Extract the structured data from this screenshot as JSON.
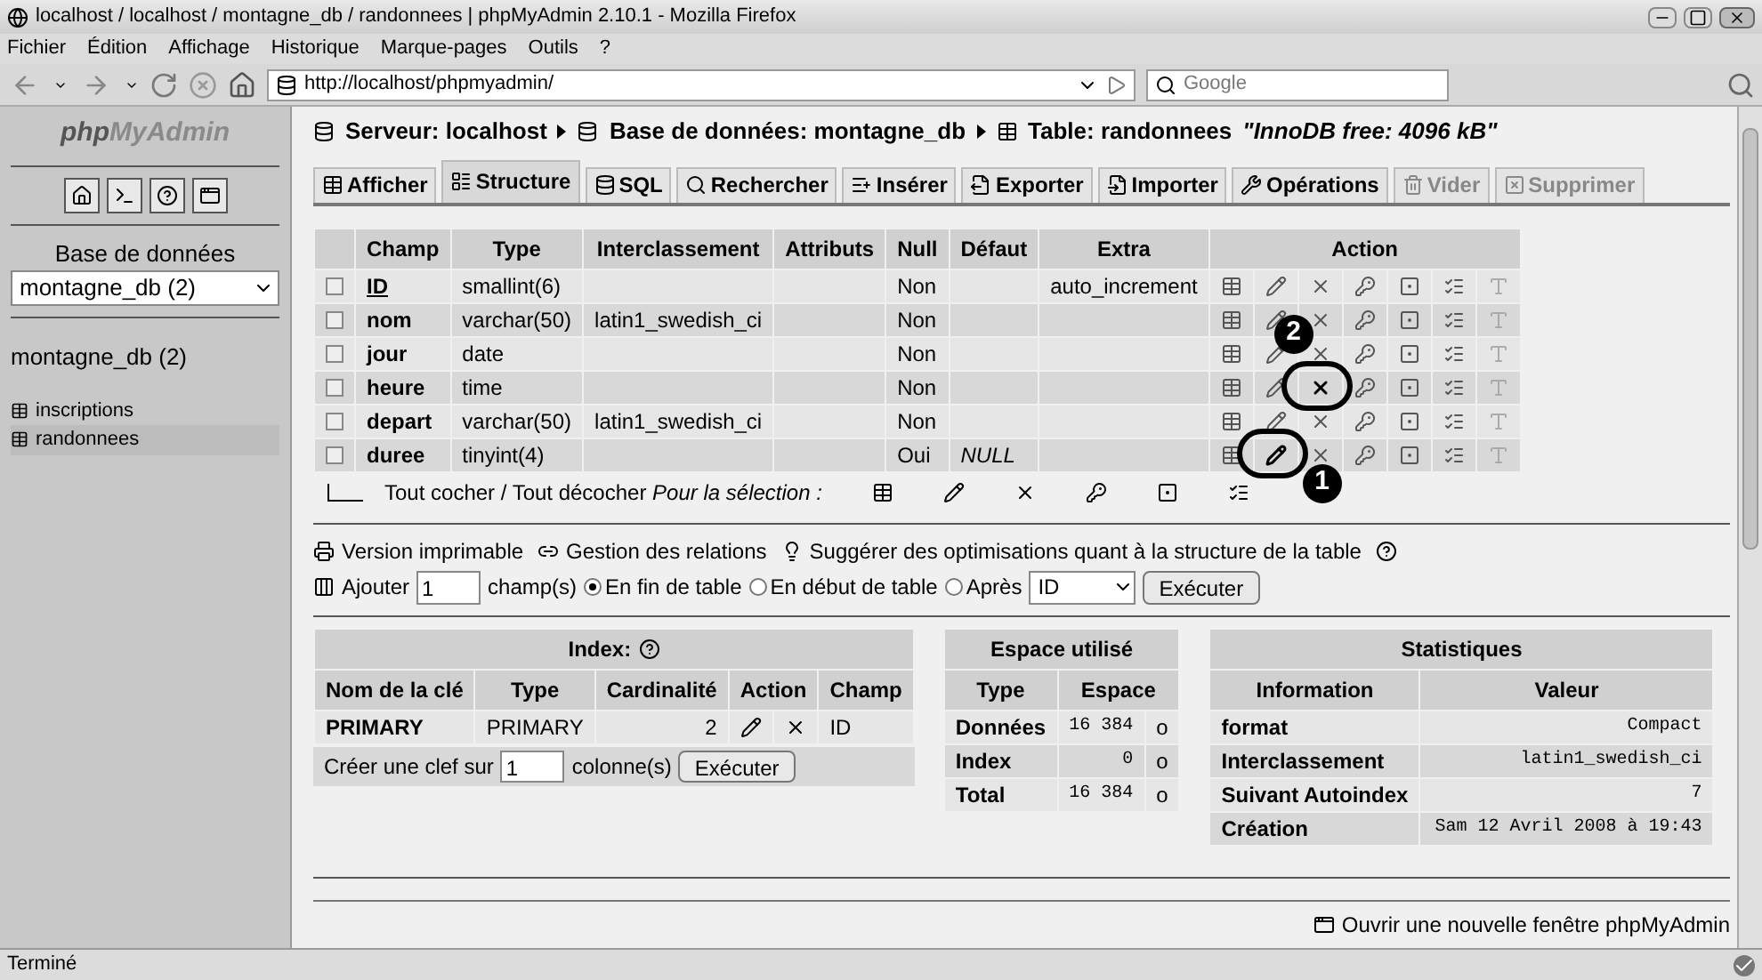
{
  "window": {
    "title": "localhost / localhost / montagne_db / randonnees | phpMyAdmin 2.10.1 - Mozilla Firefox"
  },
  "menu": [
    "Fichier",
    "Édition",
    "Affichage",
    "Historique",
    "Marque-pages",
    "Outils",
    "?"
  ],
  "navbar": {
    "url": "http://localhost/phpmyadmin/",
    "search_placeholder": "Google"
  },
  "sidebar": {
    "logo": {
      "prefix": "php",
      "suffix": "MyAdmin"
    },
    "db_label": "Base de données",
    "db_select": "montagne_db (2)",
    "db_heading": "montagne_db (2)",
    "tables": [
      {
        "label": "inscriptions",
        "selected": false
      },
      {
        "label": "randonnees",
        "selected": true
      }
    ]
  },
  "breadcrumb": {
    "server": "Serveur: localhost",
    "database": "Base de données: montagne_db",
    "table": "Table: randonnees",
    "note": "\"InnoDB free: 4096 kB\""
  },
  "tabs": [
    {
      "label": "Afficher",
      "selected": false,
      "disabled": false
    },
    {
      "label": "Structure",
      "selected": true,
      "disabled": false
    },
    {
      "label": "SQL",
      "selected": false,
      "disabled": false
    },
    {
      "label": "Rechercher",
      "selected": false,
      "disabled": false
    },
    {
      "label": "Insérer",
      "selected": false,
      "disabled": false
    },
    {
      "label": "Exporter",
      "selected": false,
      "disabled": false
    },
    {
      "label": "Importer",
      "selected": false,
      "disabled": false
    },
    {
      "label": "Opérations",
      "selected": false,
      "disabled": false
    },
    {
      "label": "Vider",
      "selected": false,
      "disabled": true
    },
    {
      "label": "Supprimer",
      "selected": false,
      "disabled": true
    }
  ],
  "structure": {
    "columns": [
      "Champ",
      "Type",
      "Interclassement",
      "Attributs",
      "Null",
      "Défaut",
      "Extra",
      "Action"
    ],
    "rows": [
      {
        "checked": false,
        "field": "ID",
        "primary": true,
        "type": "smallint(6)",
        "collation": "",
        "attributes": "",
        "null": "Non",
        "default": "",
        "extra": "auto_increment",
        "edit_circled": false,
        "drop_circled": false,
        "callout": null
      },
      {
        "checked": false,
        "field": "nom",
        "primary": false,
        "type": "varchar(50)",
        "collation": "latin1_swedish_ci",
        "attributes": "",
        "null": "Non",
        "default": "",
        "extra": "",
        "edit_circled": false,
        "drop_circled": false,
        "callout": {
          "label": "2",
          "kind": "over"
        }
      },
      {
        "checked": false,
        "field": "jour",
        "primary": false,
        "type": "date",
        "collation": "",
        "attributes": "",
        "null": "Non",
        "default": "",
        "extra": "",
        "edit_circled": false,
        "drop_circled": false,
        "callout": null
      },
      {
        "checked": false,
        "field": "heure",
        "primary": false,
        "type": "time",
        "collation": "",
        "attributes": "",
        "null": "Non",
        "default": "",
        "extra": "",
        "edit_circled": false,
        "drop_circled": true,
        "callout": null
      },
      {
        "checked": false,
        "field": "depart",
        "primary": false,
        "type": "varchar(50)",
        "collation": "latin1_swedish_ci",
        "attributes": "",
        "null": "Non",
        "default": "",
        "extra": "",
        "edit_circled": false,
        "drop_circled": false,
        "callout": null
      },
      {
        "checked": false,
        "field": "duree",
        "primary": false,
        "type": "tinyint(4)",
        "collation": "",
        "attributes": "",
        "null": "Oui",
        "default": "NULL",
        "default_null": true,
        "extra": "",
        "edit_circled": true,
        "drop_circled": false,
        "callout": {
          "label": "1",
          "kind": "below"
        }
      }
    ],
    "selection_text": "Tout cocher / Tout décocher *Pour la sélection :*"
  },
  "links": [
    "Version imprimable",
    "Gestion des relations",
    "Suggérer des optimisations quant à la structure de la table"
  ],
  "add_fields": {
    "label": "Ajouter",
    "count": "1",
    "unit": "champ(s)",
    "options": [
      {
        "label": "En fin de table",
        "selected": true
      },
      {
        "label": "En début de table",
        "selected": false
      },
      {
        "label": "Après",
        "selected": false
      }
    ],
    "after_field": "ID",
    "button": "Exécuter"
  },
  "index": {
    "title": "Index:",
    "columns": [
      "Nom de la clé",
      "Type",
      "Cardinalité",
      "Action",
      "Champ"
    ],
    "rows": [
      {
        "name": "PRIMARY",
        "type": "PRIMARY",
        "cardinality": "2",
        "field": "ID"
      }
    ],
    "create_label": "Créer une clef sur",
    "create_count": "1",
    "create_unit": "colonne(s)",
    "button": "Exécuter"
  },
  "space": {
    "title": "Espace utilisé",
    "columns": [
      "Type",
      "Espace"
    ],
    "rows": [
      {
        "type": "Données",
        "value": "16 384",
        "unit": "o"
      },
      {
        "type": "Index",
        "value": "0",
        "unit": "o"
      },
      {
        "type": "Total",
        "value": "16 384",
        "unit": "o"
      }
    ]
  },
  "stats": {
    "title": "Statistiques",
    "columns": [
      "Information",
      "Valeur"
    ],
    "rows": [
      {
        "info": "format",
        "value": "Compact"
      },
      {
        "info": "Interclassement",
        "value": "latin1_swedish_ci"
      },
      {
        "info": "Suivant Autoindex",
        "value": "7"
      },
      {
        "info": "Création",
        "value": "Sam 12 Avril 2008 à 19:43"
      }
    ]
  },
  "new_window_link": "Ouvrir une nouvelle fenêtre phpMyAdmin",
  "status_bar": "Terminé"
}
